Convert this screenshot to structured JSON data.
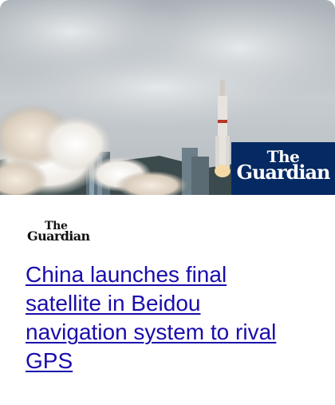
{
  "hero": {
    "logo_line1": "The",
    "logo_line2": "Guardian",
    "logo_bg_color": "#052962"
  },
  "publisher": {
    "line1": "The",
    "line2": "Guardian"
  },
  "article": {
    "headline": "China launches final satellite in Beidou navigation system to rival GPS",
    "link_color": "#1a0dab"
  }
}
